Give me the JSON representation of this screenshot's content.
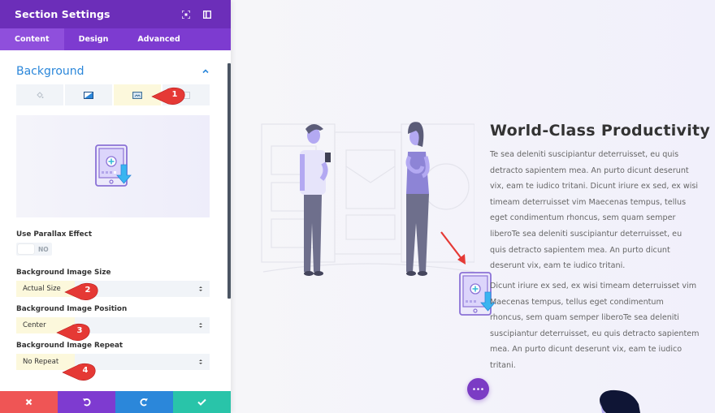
{
  "panel": {
    "title": "Section Settings",
    "header_icons": [
      "focus-icon",
      "sidebar-toggle-icon"
    ],
    "tabs": [
      {
        "label": "Content",
        "active": true
      },
      {
        "label": "Design",
        "active": false
      },
      {
        "label": "Advanced",
        "active": false
      }
    ],
    "section": {
      "title": "Background",
      "expanded": true,
      "background_types": [
        {
          "icon": "color-icon",
          "active": false
        },
        {
          "icon": "gradient-icon",
          "active": false
        },
        {
          "icon": "image-icon",
          "active": true
        },
        {
          "icon": "video-icon",
          "active": false
        }
      ],
      "preview_icon": "tablet-download-icon"
    },
    "fields": {
      "parallax": {
        "label": "Use Parallax Effect",
        "value": "NO"
      },
      "image_size": {
        "label": "Background Image Size",
        "value": "Actual Size"
      },
      "image_position": {
        "label": "Background Image Position",
        "value": "Center"
      },
      "image_repeat": {
        "label": "Background Image Repeat",
        "value": "No Repeat"
      }
    },
    "footer": {
      "cancel": "cancel-icon",
      "undo": "undo-icon",
      "redo": "redo-icon",
      "save": "check-icon"
    }
  },
  "markers": [
    "1",
    "2",
    "3",
    "4"
  ],
  "page": {
    "heading": "World-Class Productivity",
    "paragraph1": "Te sea deleniti suscipiantur deterruisset, eu quis detracto sapientem mea. An purto dicunt deserunt vix, eam te iudico tritani. Dicunt iriure ex sed, ex wisi timeam deterruisset vim Maecenas tempus, tellus eget condimentum rhoncus, sem quam semper liberoTe sea deleniti suscipiantur deterruisset, eu quis detracto sapientem mea. An purto dicunt deserunt vix, eam te iudico tritani.",
    "paragraph2": "Dicunt iriure ex sed, ex wisi timeam deterruisset vim Maecenas tempus, tellus eget condimentum rhoncus, sem quam semper liberoTe sea deleniti suscipiantur deterruisset, eu quis detracto sapientem mea. An purto dicunt deserunt vix, eam te iudico tritani."
  },
  "colors": {
    "header": "#6c2eb9",
    "tabs": "#7d3bd0",
    "accent_blue": "#2b87da",
    "cancel": "#ef5555",
    "undo": "#7e3bd0",
    "redo": "#2b87da",
    "save": "#29c4a9",
    "marker": "#e53935"
  }
}
